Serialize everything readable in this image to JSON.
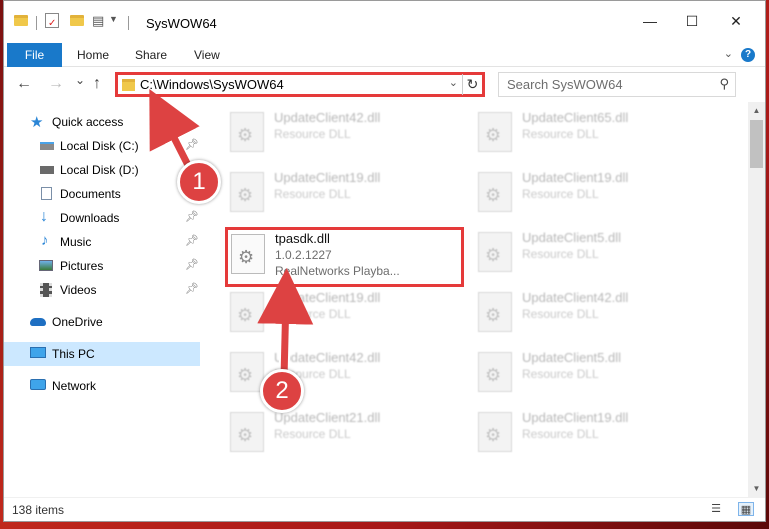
{
  "window": {
    "title": "SysWOW64",
    "controls": {
      "minimize": "—",
      "maximize": "☐",
      "close": "✕"
    }
  },
  "ribbon": {
    "tabs": [
      "File",
      "Home",
      "Share",
      "View"
    ],
    "help": "?"
  },
  "nav": {
    "back": "←",
    "forward": "→",
    "recent": "⌄",
    "up": "↑",
    "address": "C:\\Windows\\SysWOW64",
    "search_placeholder": "Search SysWOW64"
  },
  "sidebar": {
    "items": [
      {
        "label": "Quick access",
        "icon": "star-icon"
      },
      {
        "label": "Local Disk (C:)",
        "icon": "drive-icon",
        "pinned": true
      },
      {
        "label": "Local Disk (D:)",
        "icon": "drive-icon",
        "pinned": true
      },
      {
        "label": "Documents",
        "icon": "documents-icon",
        "pinned": true
      },
      {
        "label": "Downloads",
        "icon": "download-icon",
        "pinned": true
      },
      {
        "label": "Music",
        "icon": "music-icon",
        "pinned": true
      },
      {
        "label": "Pictures",
        "icon": "pictures-icon",
        "pinned": true
      },
      {
        "label": "Videos",
        "icon": "videos-icon",
        "pinned": true
      },
      {
        "label": "OneDrive",
        "icon": "cloud-icon"
      },
      {
        "label": "This PC",
        "icon": "computer-icon",
        "selected": true
      },
      {
        "label": "Network",
        "icon": "network-icon"
      }
    ]
  },
  "files": {
    "left": [
      {
        "name": "UpdateClient42.dll",
        "type": "Resource DLL"
      },
      {
        "name": "UpdateClient19.dll",
        "type": "Resource DLL"
      },
      {
        "name": "tpasdk.dll",
        "version": "1.0.2.1227",
        "company": "RealNetworks Playba...",
        "highlighted": true
      },
      {
        "name": "UpdateClient19.dll",
        "type": "Resource DLL"
      },
      {
        "name": "UpdateClient42.dll",
        "type": "Resource DLL"
      },
      {
        "name": "UpdateClient21.dll",
        "type": "Resource DLL"
      }
    ],
    "right": [
      {
        "name": "UpdateClient65.dll",
        "type": "Resource DLL"
      },
      {
        "name": "UpdateClient19.dll",
        "type": "Resource DLL"
      },
      {
        "name": "UpdateClient5.dll",
        "type": "Resource DLL"
      },
      {
        "name": "UpdateClient42.dll",
        "type": "Resource DLL"
      },
      {
        "name": "UpdateClient5.dll",
        "type": "Resource DLL"
      },
      {
        "name": "UpdateClient19.dll",
        "type": "Resource DLL"
      }
    ]
  },
  "status": {
    "count": "138 items"
  },
  "callouts": {
    "one": "1",
    "two": "2"
  },
  "colors": {
    "highlight": "#e53a3a",
    "accent": "#1979ca",
    "selected": "#cce8ff"
  }
}
